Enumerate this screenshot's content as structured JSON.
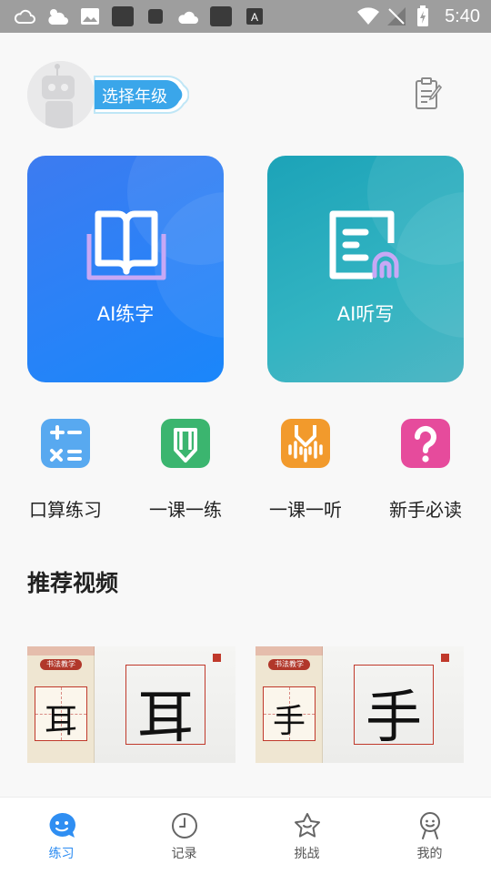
{
  "status_bar": {
    "time": "5:40",
    "left_icons": [
      "cloud-icon",
      "cloud-sun-icon",
      "image-icon",
      "app-icon",
      "square-icon",
      "cloud-icon",
      "app-icon",
      "text-app-icon"
    ],
    "right_icons": [
      "wifi-icon",
      "no-signal-icon",
      "battery-charging-icon"
    ]
  },
  "header": {
    "grade_button": "选择年级"
  },
  "cards": [
    {
      "id": "ai-write",
      "label": "AI练字",
      "icon": "open-book-icon"
    },
    {
      "id": "ai-dictation",
      "label": "AI听写",
      "icon": "document-headphone-icon"
    }
  ],
  "tools": [
    {
      "label": "口算练习",
      "icon": "calculator-icon",
      "color": "#5aa8ef"
    },
    {
      "label": "一课一练",
      "icon": "pencil-icon",
      "color": "#35b36f"
    },
    {
      "label": "一课一听",
      "icon": "audio-download-icon",
      "color": "#f39a2a"
    },
    {
      "label": "新手必读",
      "icon": "question-icon",
      "color": "#e8489b"
    }
  ],
  "section": {
    "title": "推荐视频"
  },
  "videos": [
    {
      "character": "耳",
      "book_tag": "书法教学"
    },
    {
      "character": "手",
      "book_tag": "书法教学"
    }
  ],
  "bottom_nav": [
    {
      "label": "练习",
      "icon": "smile-chat-icon",
      "active": true
    },
    {
      "label": "记录",
      "icon": "clock-icon",
      "active": false
    },
    {
      "label": "挑战",
      "icon": "star-icon",
      "active": false
    },
    {
      "label": "我的",
      "icon": "person-icon",
      "active": false
    }
  ],
  "colors": {
    "accent": "#2a8bf2",
    "card_write": "#2a82f7",
    "card_dict": "#33b4c2"
  }
}
